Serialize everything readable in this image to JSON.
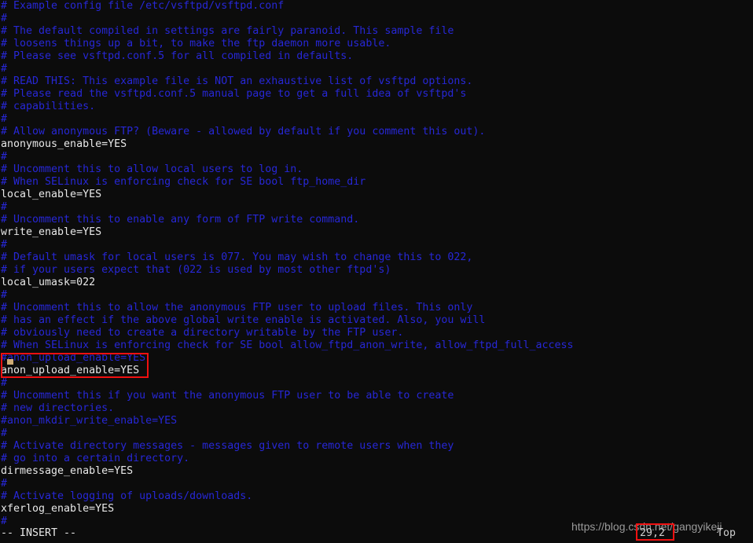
{
  "terminal": {
    "background_color": "#0c0c0c",
    "comment_color": "#2727d6",
    "text_color": "#e8e8e8",
    "highlight_color": "#f01010",
    "cursor_color": "#d9b47a"
  },
  "editor": {
    "lines": [
      {
        "text": "# Example config file /etc/vsftpd/vsftpd.conf",
        "type": "comment"
      },
      {
        "text": "#",
        "type": "comment"
      },
      {
        "text": "# The default compiled in settings are fairly paranoid. This sample file",
        "type": "comment"
      },
      {
        "text": "# loosens things up a bit, to make the ftp daemon more usable.",
        "type": "comment"
      },
      {
        "text": "# Please see vsftpd.conf.5 for all compiled in defaults.",
        "type": "comment"
      },
      {
        "text": "#",
        "type": "comment"
      },
      {
        "text": "# READ THIS: This example file is NOT an exhaustive list of vsftpd options.",
        "type": "comment"
      },
      {
        "text": "# Please read the vsftpd.conf.5 manual page to get a full idea of vsftpd's",
        "type": "comment"
      },
      {
        "text": "# capabilities.",
        "type": "comment"
      },
      {
        "text": "#",
        "type": "comment"
      },
      {
        "text": "# Allow anonymous FTP? (Beware - allowed by default if you comment this out).",
        "type": "comment"
      },
      {
        "text": "anonymous_enable=YES",
        "type": "setting"
      },
      {
        "text": "#",
        "type": "comment"
      },
      {
        "text": "# Uncomment this to allow local users to log in.",
        "type": "comment"
      },
      {
        "text": "# When SELinux is enforcing check for SE bool ftp_home_dir",
        "type": "comment"
      },
      {
        "text": "local_enable=YES",
        "type": "setting"
      },
      {
        "text": "#",
        "type": "comment"
      },
      {
        "text": "# Uncomment this to enable any form of FTP write command.",
        "type": "comment"
      },
      {
        "text": "write_enable=YES",
        "type": "setting"
      },
      {
        "text": "#",
        "type": "comment"
      },
      {
        "text": "# Default umask for local users is 077. You may wish to change this to 022,",
        "type": "comment"
      },
      {
        "text": "# if your users expect that (022 is used by most other ftpd's)",
        "type": "comment"
      },
      {
        "text": "local_umask=022",
        "type": "setting"
      },
      {
        "text": "#",
        "type": "comment"
      },
      {
        "text": "# Uncomment this to allow the anonymous FTP user to upload files. This only",
        "type": "comment"
      },
      {
        "text": "# has an effect if the above global write enable is activated. Also, you will",
        "type": "comment"
      },
      {
        "text": "# obviously need to create a directory writable by the FTP user.",
        "type": "comment"
      },
      {
        "text": "# When SELinux is enforcing check for SE bool allow_ftpd_anon_write, allow_ftpd_full_access",
        "type": "comment"
      },
      {
        "text": "#anon_upload_enable=YES",
        "type": "comment"
      },
      {
        "text": "anon_upload_enable=YES",
        "type": "setting"
      },
      {
        "text": "#",
        "type": "comment"
      },
      {
        "text": "# Uncomment this if you want the anonymous FTP user to be able to create",
        "type": "comment"
      },
      {
        "text": "# new directories.",
        "type": "comment"
      },
      {
        "text": "#anon_mkdir_write_enable=YES",
        "type": "comment"
      },
      {
        "text": "#",
        "type": "comment"
      },
      {
        "text": "# Activate directory messages - messages given to remote users when they",
        "type": "comment"
      },
      {
        "text": "# go into a certain directory.",
        "type": "comment"
      },
      {
        "text": "dirmessage_enable=YES",
        "type": "setting"
      },
      {
        "text": "#",
        "type": "comment"
      },
      {
        "text": "# Activate logging of uploads/downloads.",
        "type": "comment"
      },
      {
        "text": "xferlog_enable=YES",
        "type": "setting"
      },
      {
        "text": "#",
        "type": "comment"
      }
    ]
  },
  "status": {
    "mode": "-- INSERT --",
    "ruler": "29,2",
    "file_position": "Top"
  },
  "watermark": {
    "text": "https://blog.csdn.net/gangyikeji"
  },
  "annotations": {
    "anon_upload_box_label": "anon-upload-enable-highlight",
    "ruler_box_label": "cursor-position-highlight"
  }
}
